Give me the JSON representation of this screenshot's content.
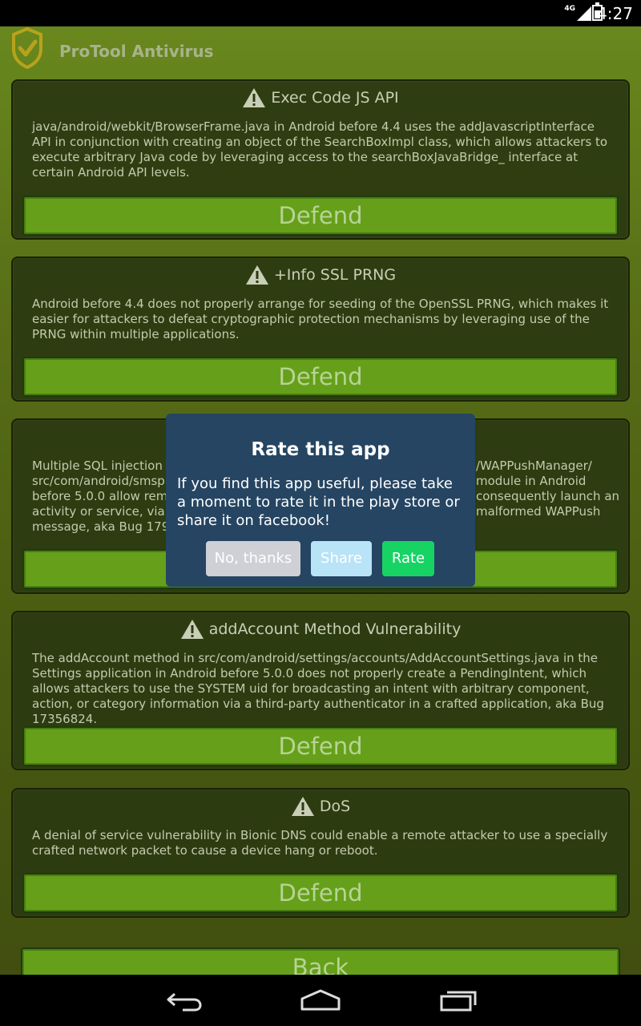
{
  "status_bar": {
    "network": "4G",
    "time": "4:27"
  },
  "app_bar": {
    "title": "ProTool Antivirus",
    "logo_icon": "shield-check-icon"
  },
  "cards": [
    {
      "title": "Exec Code JS API",
      "description": "java/android/webkit/BrowserFrame.java in Android before 4.4 uses the addJavascriptInterface API in conjunction with creating an object of the SearchBoxImpl class, which allows attackers to execute arbitrary Java code by leveraging access to the searchBoxJavaBridge_ interface at certain Android API levels.",
      "button": "Defend"
    },
    {
      "title": "+Info SSL PRNG",
      "description": "Android before 4.4 does not properly arrange for seeding of the OpenSSL PRNG, which makes it easier for attackers to defeat cryptographic protection mechanisms by leveraging use of the PRNG within multiple applications.",
      "button": "Defend"
    },
    {
      "title": "",
      "description_left": "Multiple SQL injection v\nsrc/com/android/smsp\nbefore 5.0.0 allow remot\nactivity or service, via th\nmessage, aka Bug 1796",
      "description_right": "/WAPPushManager/\nmodule in Android\nconsequently launch an\nmalformed WAPPush",
      "button": ""
    },
    {
      "title": "addAccount Method Vulnerability",
      "description": "The addAccount method in src/com/android/settings/accounts/AddAccountSettings.java in the Settings application in Android before 5.0.0 does not properly create a PendingIntent, which allows attackers to use the SYSTEM uid for broadcasting an intent with arbitrary component, action, or category information via a third-party authenticator in a crafted application, aka Bug 17356824.",
      "button": "Defend"
    },
    {
      "title": "DoS",
      "description": "A denial of service vulnerability in Bionic DNS could enable a remote attacker to use a specially crafted network packet to cause a device hang or reboot.",
      "button": "Defend"
    }
  ],
  "back_button": "Back",
  "dialog": {
    "title": "Rate this app",
    "message": "If you find this app useful, please take a moment to rate it in the play store or share it on facebook!",
    "buttons": {
      "no": "No, thanks",
      "share": "Share",
      "rate": "Rate"
    }
  },
  "nav_bar": {
    "back_icon": "back-icon",
    "home_icon": "home-icon",
    "recents_icon": "recents-icon"
  },
  "colors": {
    "accent_green": "#66a01a",
    "dialog_bg": "#254562",
    "rate_button": "#17d364",
    "share_button": "#b9e3f6"
  }
}
